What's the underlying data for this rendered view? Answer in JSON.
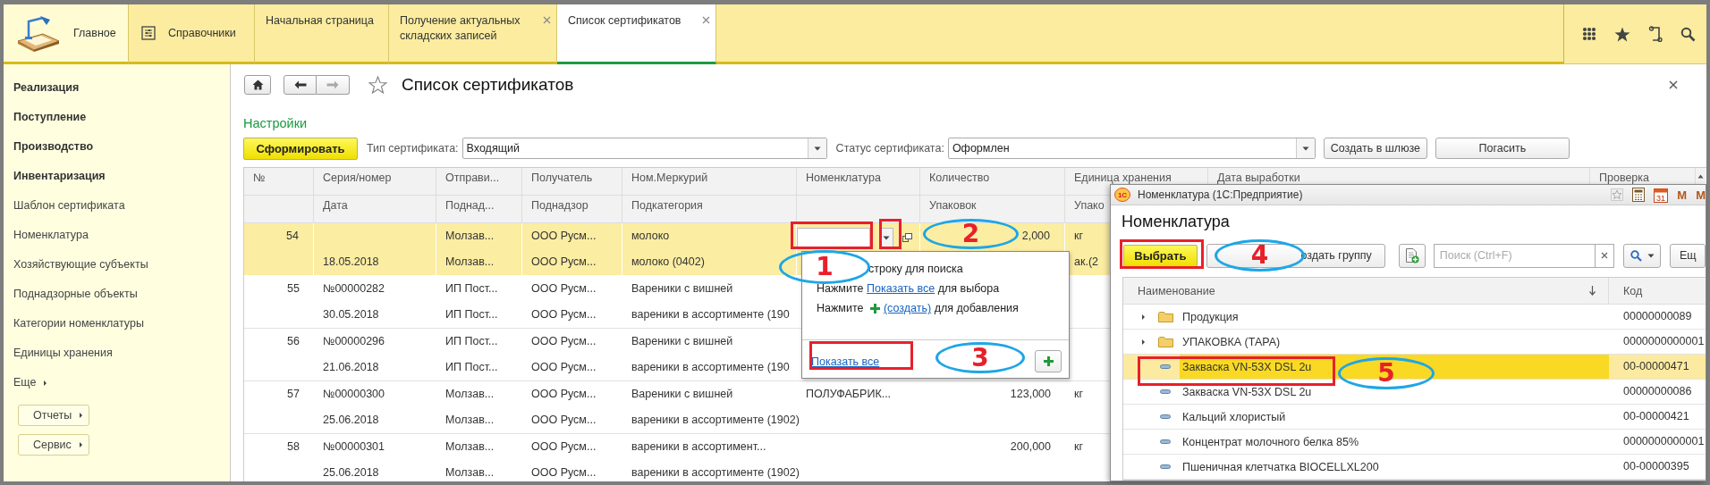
{
  "top_bar": {
    "sections": [
      {
        "label": "Главное",
        "selected": true
      },
      {
        "label": "Справочники",
        "selected": false
      }
    ],
    "tabs": [
      {
        "label": "Начальная страница",
        "closable": false,
        "selected": false
      },
      {
        "label": "Получение актуальных складских записей",
        "closable": true,
        "selected": false
      },
      {
        "label": "Список сертификатов",
        "closable": true,
        "selected": true
      }
    ]
  },
  "sidebar": {
    "items": [
      {
        "label": "Реализация",
        "kind": "section"
      },
      {
        "label": "Поступление",
        "kind": "section"
      },
      {
        "label": "Производство",
        "kind": "section"
      },
      {
        "label": "Инвентаризация",
        "kind": "section"
      },
      {
        "label": "Шаблон сертификата",
        "kind": "link"
      },
      {
        "label": "Номенклатура",
        "kind": "link"
      },
      {
        "label": "Хозяйствующие субъекты",
        "kind": "link"
      },
      {
        "label": "Поднадзорные объекты",
        "kind": "link"
      },
      {
        "label": "Категории номенклатуры",
        "kind": "link"
      },
      {
        "label": "Единицы хранения",
        "kind": "link"
      },
      {
        "label": "Еще",
        "kind": "more"
      },
      {
        "label": "Отчеты",
        "kind": "button"
      },
      {
        "label": "Сервис",
        "kind": "button"
      }
    ]
  },
  "form": {
    "title": "Список сертификатов",
    "settings_link": "Настройки",
    "generate_button": "Сформировать",
    "filters": [
      {
        "label": "Тип сертификата:",
        "value": "Входящий"
      },
      {
        "label": "Статус сертификата:",
        "value": "Оформлен"
      }
    ],
    "buttons": [
      "Создать в шлюзе",
      "Погасить"
    ]
  },
  "table": {
    "columns": [
      {
        "line1": "№"
      },
      {
        "line1": "Серия/номер",
        "line2": "Дата"
      },
      {
        "line1": "Отправи...",
        "line2": "Поднад..."
      },
      {
        "line1": "Получатель",
        "line2": "Поднадзор"
      },
      {
        "line1": "Ном.Меркурий",
        "line2": "Подкатегория"
      },
      {
        "line1": "Номенклатура"
      },
      {
        "line1": "Количество",
        "line2": "Упаковок"
      },
      {
        "line1": "Единица хранения",
        "line2": "Упако"
      },
      {
        "line1": "Дата выработки"
      },
      {
        "line1": "Проверка"
      }
    ],
    "rows": [
      {
        "selected": true,
        "line1": {
          "number": "54",
          "sender": "Молзав...",
          "recipient": "ООО Русм...",
          "mercury_name": "молоко",
          "nomenclature": {
            "kind": "lookup_field"
          },
          "quantity": "2,000",
          "unit": "кг"
        },
        "line2": {
          "date": "18.05.2018",
          "sender_supervision": "Молзав...",
          "recipient_supervision": "ООО Русм...",
          "subcategory": "молоко (0402)",
          "unit_packages": "ак.(2"
        }
      },
      {
        "selected": false,
        "line1": {
          "number": "55",
          "series_number": "№00000282",
          "sender": "ИП Пост...",
          "recipient": "ООО Русм...",
          "mercury_name": "Вареники с вишней"
        },
        "line2": {
          "date": "30.05.2018",
          "sender_supervision": "ИП Пост...",
          "recipient_supervision": "ООО Русм...",
          "subcategory": "вареники в ассортименте (190"
        }
      },
      {
        "selected": false,
        "line1": {
          "number": "56",
          "series_number": "№00000296",
          "sender": "ИП Пост...",
          "recipient": "ООО Русм...",
          "mercury_name": "Вареники с вишней"
        },
        "line2": {
          "date": "21.06.2018",
          "sender_supervision": "ИП Пост...",
          "recipient_supervision": "ООО Русм...",
          "subcategory": "вареники в ассортименте (190"
        }
      },
      {
        "selected": false,
        "line1": {
          "number": "57",
          "series_number": "№00000300",
          "sender": "Молзав...",
          "recipient": "ООО Русм...",
          "mercury_name": "Вареники с вишней",
          "nomenclature": "ПОЛУФАБРИК...",
          "quantity": "123,000",
          "unit": "кг"
        },
        "line2": {
          "date": "25.06.2018",
          "sender_supervision": "Молзав...",
          "recipient_supervision": "ООО Русм...",
          "subcategory": "вареники в ассортименте (1902)"
        }
      },
      {
        "selected": false,
        "line1": {
          "number": "58",
          "series_number": "№00000301",
          "sender": "Молзав...",
          "recipient": "ООО Русм...",
          "mercury_name": "вареники в ассортимент...",
          "quantity": "200,000",
          "unit": "кг"
        },
        "line2": {
          "date": "25.06.2018",
          "sender_supervision": "Молзав...",
          "recipient_supervision": "ООО Русм...",
          "subcategory": "вареники в ассортименте (1902)"
        }
      }
    ]
  },
  "dropdown": {
    "lines": [
      {
        "kind": "hint",
        "before": "строку для поиска"
      },
      {
        "kind": "link",
        "before": "Нажмите",
        "link": "Показать все",
        "after": "для выбора"
      },
      {
        "kind": "create",
        "before": "Нажмите",
        "link": "(создать)",
        "after": "для добавления"
      }
    ],
    "footer_link": "Показать все"
  },
  "window": {
    "logo_text": "1С",
    "title": "Номенклатура (1С:Предприятие)",
    "calendar_label": "31",
    "title_buttons": [
      "M",
      "M"
    ],
    "heading": "Номенклатура",
    "select_button": "Выбрать",
    "group_button": "оздать группу",
    "search": {
      "placeholder": "Поиск (Ctrl+F)"
    },
    "more_button": "Ещ",
    "columns": [
      "Наименование",
      "Код"
    ],
    "rows": [
      {
        "kind": "folder",
        "name": "Продукция",
        "code": "00000000089",
        "selected": false
      },
      {
        "kind": "folder",
        "name": "УПАКОВКА (ТАРА)",
        "code": "0000000000001",
        "selected": false
      },
      {
        "kind": "item",
        "name": "Закваска VN-53X DSL 2u",
        "code": "00-00000471",
        "selected": true
      },
      {
        "kind": "item",
        "name": "Закваска VN-53X DSL 2u",
        "code": "00000000086",
        "selected": false
      },
      {
        "kind": "item",
        "name": "Кальций хлористый",
        "code": "00-00000421",
        "selected": false
      },
      {
        "kind": "item",
        "name": "Концентрат молочного белка 85%",
        "code": "0000000000001",
        "selected": false
      },
      {
        "kind": "item",
        "name": "Пшеничная клетчатка BIOCELLXL200",
        "code": "00-00000395",
        "selected": false
      }
    ]
  },
  "annotations": [
    {
      "kind": "frame"
    },
    {
      "kind": "frame"
    },
    {
      "kind": "ellipse",
      "label": "2"
    },
    {
      "kind": "ellipse",
      "label": "1"
    },
    {
      "kind": "frame"
    },
    {
      "kind": "ellipse",
      "label": "3"
    },
    {
      "kind": "frame"
    },
    {
      "kind": "ellipse",
      "label": "4"
    },
    {
      "kind": "frame"
    },
    {
      "kind": "ellipse",
      "label": "5"
    }
  ]
}
